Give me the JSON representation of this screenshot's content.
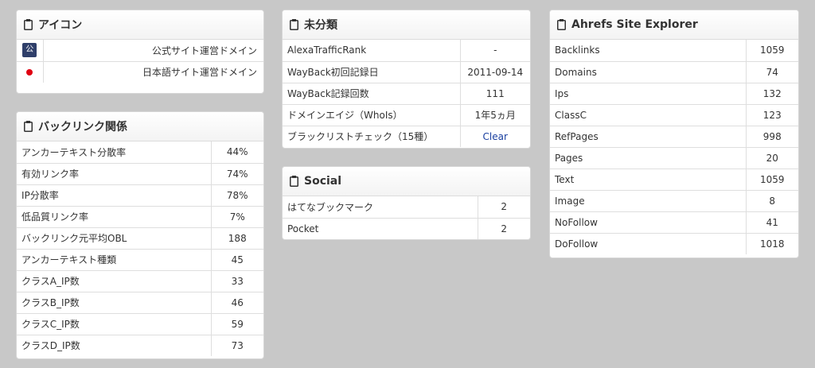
{
  "icon_panel": {
    "title": "アイコン",
    "rows": [
      {
        "glyph": "公",
        "label": "公式サイト運営ドメイン"
      },
      {
        "label": "日本語サイト運営ドメイン"
      }
    ]
  },
  "backlink_panel": {
    "title": "バックリンク関係",
    "rows": [
      {
        "label": "アンカーテキスト分散率",
        "value": "44%"
      },
      {
        "label": "有効リンク率",
        "value": "74%"
      },
      {
        "label": "IP分散率",
        "value": "78%"
      },
      {
        "label": "低品質リンク率",
        "value": "7%"
      },
      {
        "label": "バックリンク元平均OBL",
        "value": "188"
      },
      {
        "label": "アンカーテキスト種類",
        "value": "45"
      },
      {
        "label": "クラスA_IP数",
        "value": "33"
      },
      {
        "label": "クラスB_IP数",
        "value": "46"
      },
      {
        "label": "クラスC_IP数",
        "value": "59"
      },
      {
        "label": "クラスD_IP数",
        "value": "73"
      }
    ]
  },
  "misc_panel": {
    "title": "未分類",
    "rows": [
      {
        "label": "AlexaTrafficRank",
        "value": "-"
      },
      {
        "label": "WayBack初回記録日",
        "value": "2011-09-14"
      },
      {
        "label": "WayBack記録回数",
        "value": "111"
      },
      {
        "label": "ドメインエイジ（WhoIs）",
        "value": "1年5ヵ月"
      },
      {
        "label": "ブラックリストチェック（15種）",
        "value": "Clear"
      }
    ]
  },
  "social_panel": {
    "title": "Social",
    "rows": [
      {
        "label": "はてなブックマーク",
        "value": "2"
      },
      {
        "label": "Pocket",
        "value": "2"
      }
    ]
  },
  "ahrefs_panel": {
    "title": "Ahrefs Site Explorer",
    "rows": [
      {
        "label": "Backlinks",
        "value": "1059"
      },
      {
        "label": "Domains",
        "value": "74"
      },
      {
        "label": "Ips",
        "value": "132"
      },
      {
        "label": "ClassC",
        "value": "123"
      },
      {
        "label": "RefPages",
        "value": "998"
      },
      {
        "label": "Pages",
        "value": "20"
      },
      {
        "label": "Text",
        "value": "1059"
      },
      {
        "label": "Image",
        "value": "8"
      },
      {
        "label": "NoFollow",
        "value": "41"
      },
      {
        "label": "DoFollow",
        "value": "1018"
      }
    ]
  }
}
